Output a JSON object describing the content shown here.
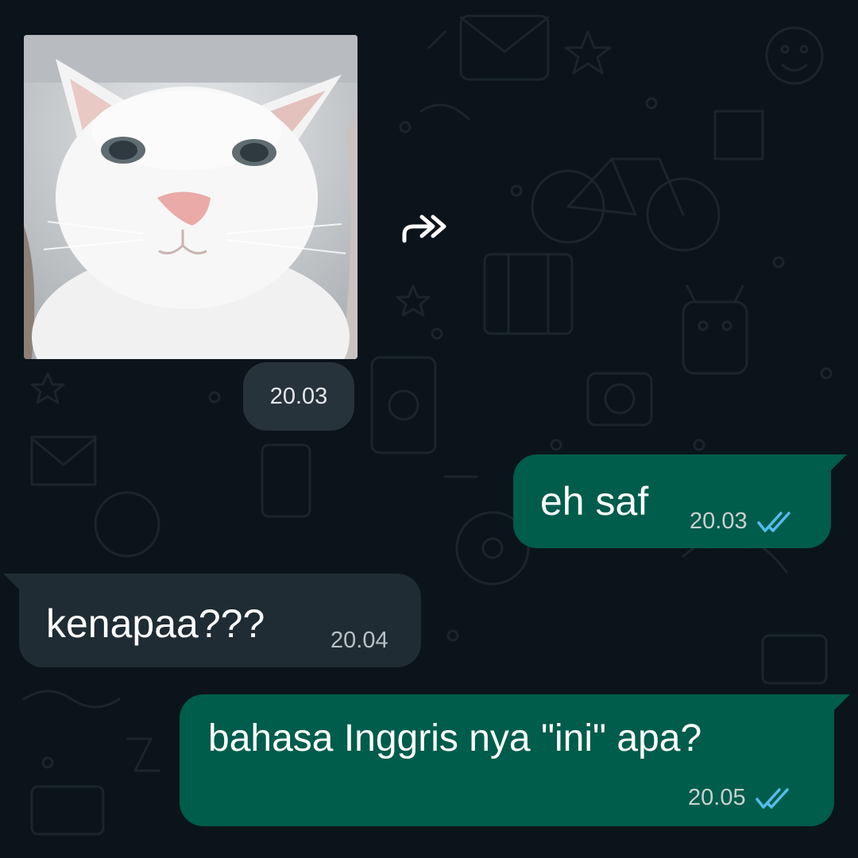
{
  "chat": {
    "image_message": {
      "time": "20.03",
      "forward_icon": "forward-double-arrow-icon",
      "image_subject": "white cat photo"
    },
    "messages": [
      {
        "direction": "outgoing",
        "text": "eh saf",
        "time": "20.03",
        "status_icon": "double-check-read-icon"
      },
      {
        "direction": "incoming",
        "text": "kenapaa???",
        "time": "20.04"
      },
      {
        "direction": "outgoing",
        "text": "bahasa Inggris nya \"ini\" apa?",
        "time": "20.05",
        "status_icon": "double-check-read-icon"
      }
    ]
  },
  "colors": {
    "background": "#0b141a",
    "outgoing_bubble": "#005c4b",
    "incoming_bubble": "#1f2c34",
    "time_pill": "#27333b",
    "read_tick": "#53bdeb"
  }
}
